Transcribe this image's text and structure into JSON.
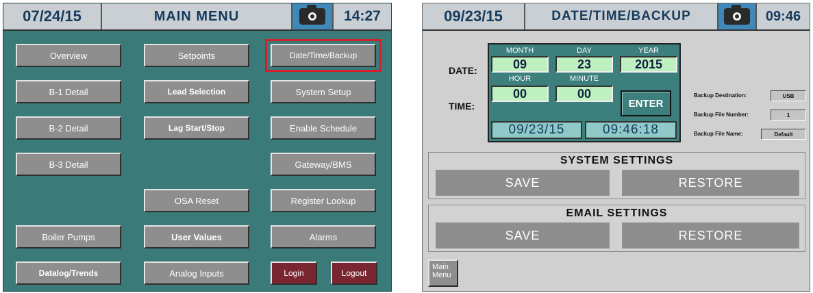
{
  "main_menu": {
    "header": {
      "date": "07/24/15",
      "title": "MAIN MENU",
      "time": "14:27",
      "camera_icon": "camera-icon"
    },
    "buttons": {
      "overview": "Overview",
      "setpoints": "Setpoints",
      "date_time_backup": "Date/Time/Backup",
      "b1_detail": "B-1 Detail",
      "lead_selection": "Lead Selection",
      "system_setup": "System Setup",
      "b2_detail": "B-2 Detail",
      "lag_start_stop": "Lag Start/Stop",
      "enable_schedule": "Enable Schedule",
      "b3_detail": "B-3 Detail",
      "gateway_bms": "Gateway/BMS",
      "osa_reset": "OSA Reset",
      "register_lookup": "Register Lookup",
      "boiler_pumps": "Boiler Pumps",
      "user_values": "User Values",
      "alarms": "Alarms",
      "datalog_trends": "Datalog/Trends",
      "analog_inputs": "Analog Inputs",
      "login": "Login",
      "logout": "Logout"
    }
  },
  "date_time_backup": {
    "header": {
      "date": "09/23/15",
      "title": "DATE/TIME/BACKUP",
      "time": "09:46",
      "camera_icon": "camera-icon"
    },
    "labels": {
      "date": "DATE:",
      "time": "TIME:"
    },
    "columns": {
      "month": "MONTH",
      "day": "DAY",
      "year": "YEAR",
      "hour": "HOUR",
      "minute": "MINUTE"
    },
    "values": {
      "month": "09",
      "day": "23",
      "year": "2015",
      "hour": "00",
      "minute": "00"
    },
    "enter_label": "ENTER",
    "current_date": "09/23/15",
    "current_time": "09:46:18",
    "backup": {
      "destination_label": "Backup Destination:",
      "destination_value": "USB",
      "file_number_label": "Backup File Number:",
      "file_number_value": "1",
      "file_name_label": "Backup File Name:",
      "file_name_value": "Default"
    },
    "system_settings": {
      "title": "SYSTEM SETTINGS",
      "save": "SAVE",
      "restore": "RESTORE"
    },
    "email_settings": {
      "title": "EMAIL SETTINGS",
      "save": "SAVE",
      "restore": "RESTORE"
    },
    "main_menu_button": "Main Menu"
  },
  "colors": {
    "panel_teal": "#3a7a78",
    "button_gray": "#8e8e8e",
    "login_red": "#7a2630",
    "highlight_red": "#d4202a",
    "value_green": "#bff0bf",
    "camera_blue": "#3f88b8"
  }
}
